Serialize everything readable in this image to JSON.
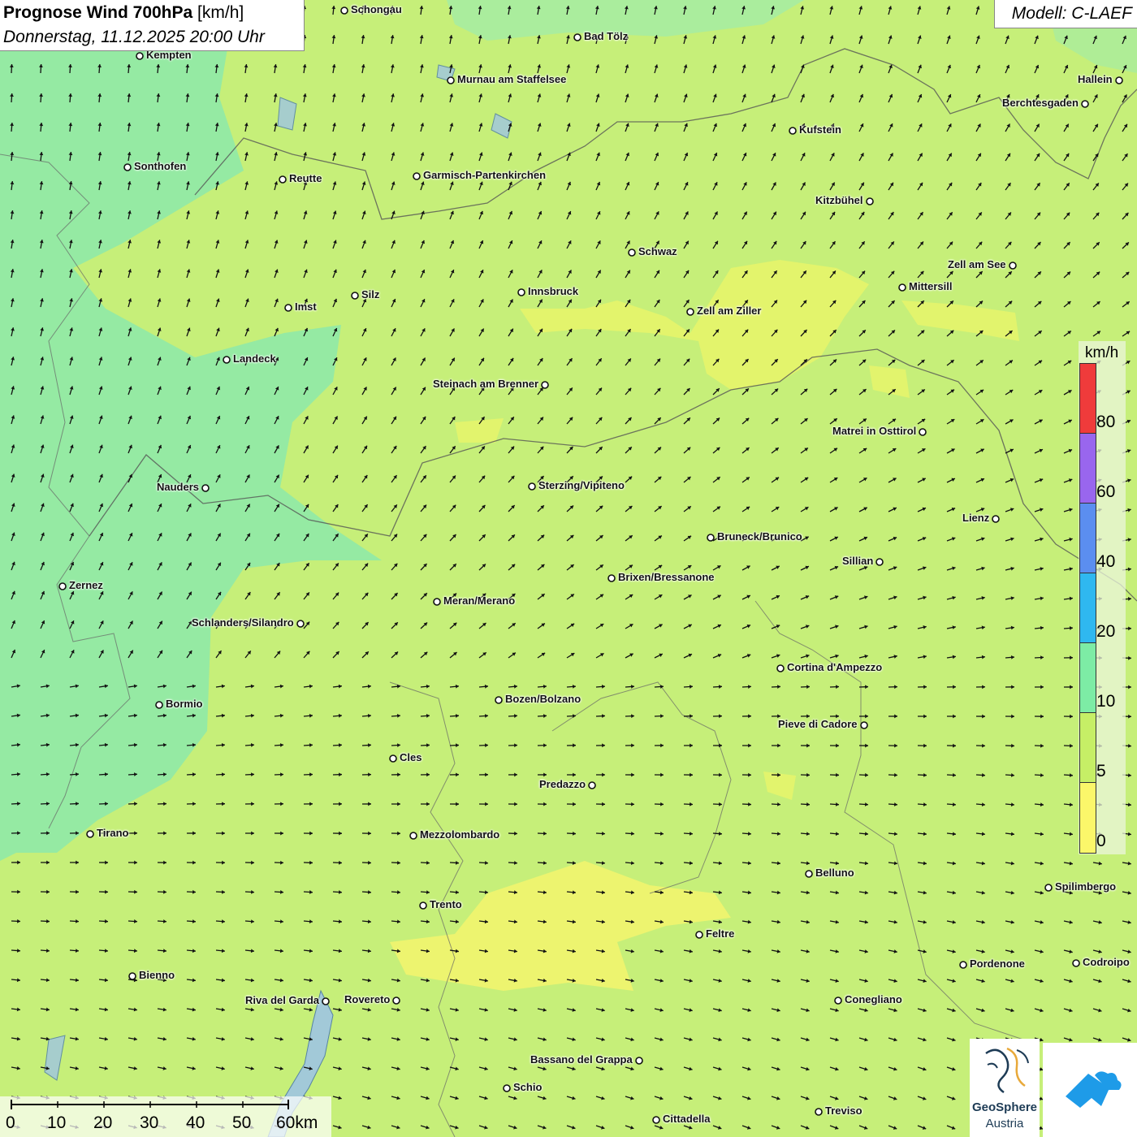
{
  "header": {
    "title_bold": "Prognose Wind 700hPa",
    "title_unit": " [km/h]",
    "datetime": "Donnerstag, 11.12.2025 20:00 Uhr",
    "model": "Modell: C-LAEF"
  },
  "legend": {
    "unit": "km/h",
    "ticks": [
      "80",
      "60",
      "40",
      "20",
      "10",
      "5",
      "0"
    ],
    "colors": [
      "#ef3b3b",
      "#9966ee",
      "#5b8ef0",
      "#2fb8f0",
      "#7deca5",
      "#c6ef66",
      "#fbf76a"
    ]
  },
  "scale_bar": {
    "labels": [
      "0",
      "10",
      "20",
      "30",
      "40",
      "50",
      "60km"
    ]
  },
  "logos": {
    "geosphere_line1": "GeoSphere",
    "geosphere_line2": "Austria"
  },
  "cities": [
    {
      "name": "Schongau"
    },
    {
      "name": "Bad Tölz"
    },
    {
      "name": "Kempten"
    },
    {
      "name": "Murnau am Staffelsee"
    },
    {
      "name": "Hallein"
    },
    {
      "name": "Berchtesgaden"
    },
    {
      "name": "Kufstein"
    },
    {
      "name": "Sonthofen"
    },
    {
      "name": "Reutte"
    },
    {
      "name": "Garmisch-Partenkirchen"
    },
    {
      "name": "Kitzbühel"
    },
    {
      "name": "Schwaz"
    },
    {
      "name": "Zell am See"
    },
    {
      "name": "Mittersill"
    },
    {
      "name": "Innsbruck"
    },
    {
      "name": "Imst"
    },
    {
      "name": "Silz"
    },
    {
      "name": "Zell am Ziller"
    },
    {
      "name": "Landeck"
    },
    {
      "name": "Steinach am Brenner"
    },
    {
      "name": "Matrei in Osttirol"
    },
    {
      "name": "Nauders"
    },
    {
      "name": "Sterzing/Vipiteno"
    },
    {
      "name": "Lienz"
    },
    {
      "name": "Bruneck/Brunico"
    },
    {
      "name": "Sillian"
    },
    {
      "name": "Brixen/Bressanone"
    },
    {
      "name": "Zernez"
    },
    {
      "name": "Meran/Merano"
    },
    {
      "name": "Schlanders/Silandro"
    },
    {
      "name": "Cortina d'Ampezzo"
    },
    {
      "name": "Bozen/Bolzano"
    },
    {
      "name": "Bormio"
    },
    {
      "name": "Pieve di Cadore"
    },
    {
      "name": "Cles"
    },
    {
      "name": "Predazzo"
    },
    {
      "name": "Tirano"
    },
    {
      "name": "Mezzolombardo"
    },
    {
      "name": "Belluno"
    },
    {
      "name": "Spilimbergo"
    },
    {
      "name": "Trento"
    },
    {
      "name": "Feltre"
    },
    {
      "name": "Pordenone"
    },
    {
      "name": "Codroipo"
    },
    {
      "name": "Bienno"
    },
    {
      "name": "Riva del Garda"
    },
    {
      "name": "Rovereto"
    },
    {
      "name": "Conegliano"
    },
    {
      "name": "Bassano del Grappa"
    },
    {
      "name": "Schio"
    },
    {
      "name": "Treviso"
    },
    {
      "name": "Cittadella"
    }
  ]
}
